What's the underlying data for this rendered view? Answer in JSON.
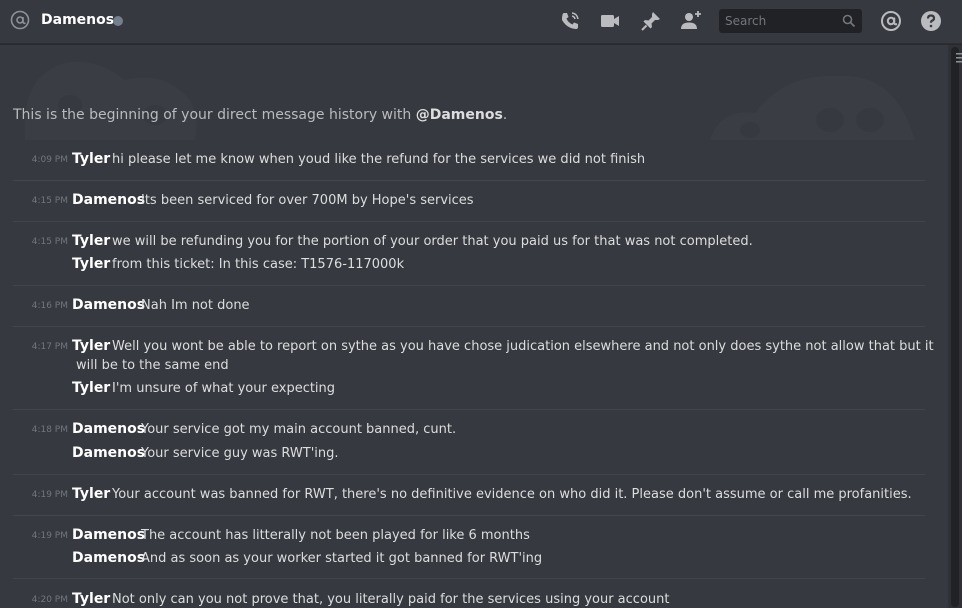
{
  "header": {
    "channel_name": "Damenos",
    "search_placeholder": "Search",
    "icons": [
      "at-icon",
      "call-icon",
      "video-icon",
      "pin-icon",
      "add-friend-icon",
      "search-icon",
      "mention-icon",
      "help-icon"
    ]
  },
  "intro": {
    "text": "This is the beginning of your direct message history with ",
    "handle": "@Damenos",
    "end": "."
  },
  "messages": [
    {
      "time": "4:09 PM",
      "lines": [
        {
          "author": "Tyler",
          "text": "hi please let me know when youd like the refund for the services we did not finish"
        }
      ]
    },
    {
      "time": "4:15 PM",
      "lines": [
        {
          "author": "Damenos",
          "text": "Its been serviced for over 700M by Hope's services"
        }
      ]
    },
    {
      "time": "4:15 PM",
      "lines": [
        {
          "author": "Tyler",
          "text": "we will be refunding you for the portion of your order that you paid us for that was not completed."
        },
        {
          "author": "Tyler",
          "text": "from this ticket: In this case: T1576-117000k"
        }
      ]
    },
    {
      "time": "4:16 PM",
      "lines": [
        {
          "author": "Damenos",
          "text": "Nah Im not done"
        }
      ]
    },
    {
      "time": "4:17 PM",
      "lines": [
        {
          "author": "Tyler",
          "text": "Well you wont be able to report on sythe as you have chose judication elsewhere and not only does sythe not allow that but it",
          "cont": "will be to the same end"
        },
        {
          "author": "Tyler",
          "text": "I'm unsure of what your expecting"
        }
      ]
    },
    {
      "time": "4:18 PM",
      "lines": [
        {
          "author": "Damenos",
          "text": "Your service got my main account banned, cunt."
        },
        {
          "author": "Damenos",
          "text": "Your service guy was RWT'ing."
        }
      ]
    },
    {
      "time": "4:19 PM",
      "lines": [
        {
          "author": "Tyler",
          "text": "Your account was banned for RWT, there's no definitive evidence on who did it. Please don't assume or call me profanities."
        }
      ]
    },
    {
      "time": "4:19 PM",
      "lines": [
        {
          "author": "Damenos",
          "text": "The account has litterally not been played for like 6 months"
        },
        {
          "author": "Damenos",
          "text": "And as soon as your worker started it got banned for RWT'ing"
        }
      ]
    },
    {
      "time": "4:20 PM",
      "lines": [
        {
          "author": "Tyler",
          "text": "Not only can you not prove that, you literally paid for the services using your account"
        }
      ]
    }
  ]
}
